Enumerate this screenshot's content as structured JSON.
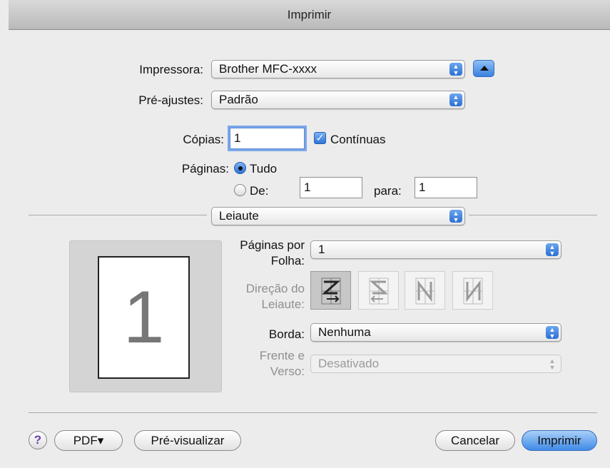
{
  "window": {
    "title": "Imprimir"
  },
  "printer": {
    "label": "Impressora:",
    "value": "Brother MFC-xxxx"
  },
  "presets": {
    "label": "Pré-ajustes:",
    "value": "Padrão"
  },
  "copies": {
    "label": "Cópias:",
    "value": "1",
    "collated_label": "Contínuas",
    "collated_checked": true
  },
  "pages": {
    "label": "Páginas:",
    "all_label": "Tudo",
    "from_label": "De:",
    "from_value": "1",
    "to_label": "para:",
    "to_value": "1",
    "selected": "Tudo"
  },
  "panel": {
    "value": "Leiaute"
  },
  "layout": {
    "pages_per_sheet_label_1": "Páginas por",
    "pages_per_sheet_label_2": "Folha:",
    "pages_per_sheet_value": "1",
    "direction_label_1": "Direção do",
    "direction_label_2": "Leiaute:",
    "border_label": "Borda:",
    "border_value": "Nenhuma",
    "duplex_label_1": "Frente e",
    "duplex_label_2": "Verso:",
    "duplex_value": "Desativado",
    "preview_number": "1"
  },
  "footer": {
    "help_label": "?",
    "pdf_label": "PDF▾",
    "preview_label": "Pré-visualizar",
    "cancel_label": "Cancelar",
    "print_label": "Imprimir"
  },
  "icons": {
    "popup_arrows": "up-down-arrows-icon",
    "disclosure": "disclosure-triangle-up-icon",
    "check": "checkmark-icon"
  },
  "colors": {
    "accent": "#3a80e0",
    "help_mark": "#6b3fa6"
  }
}
